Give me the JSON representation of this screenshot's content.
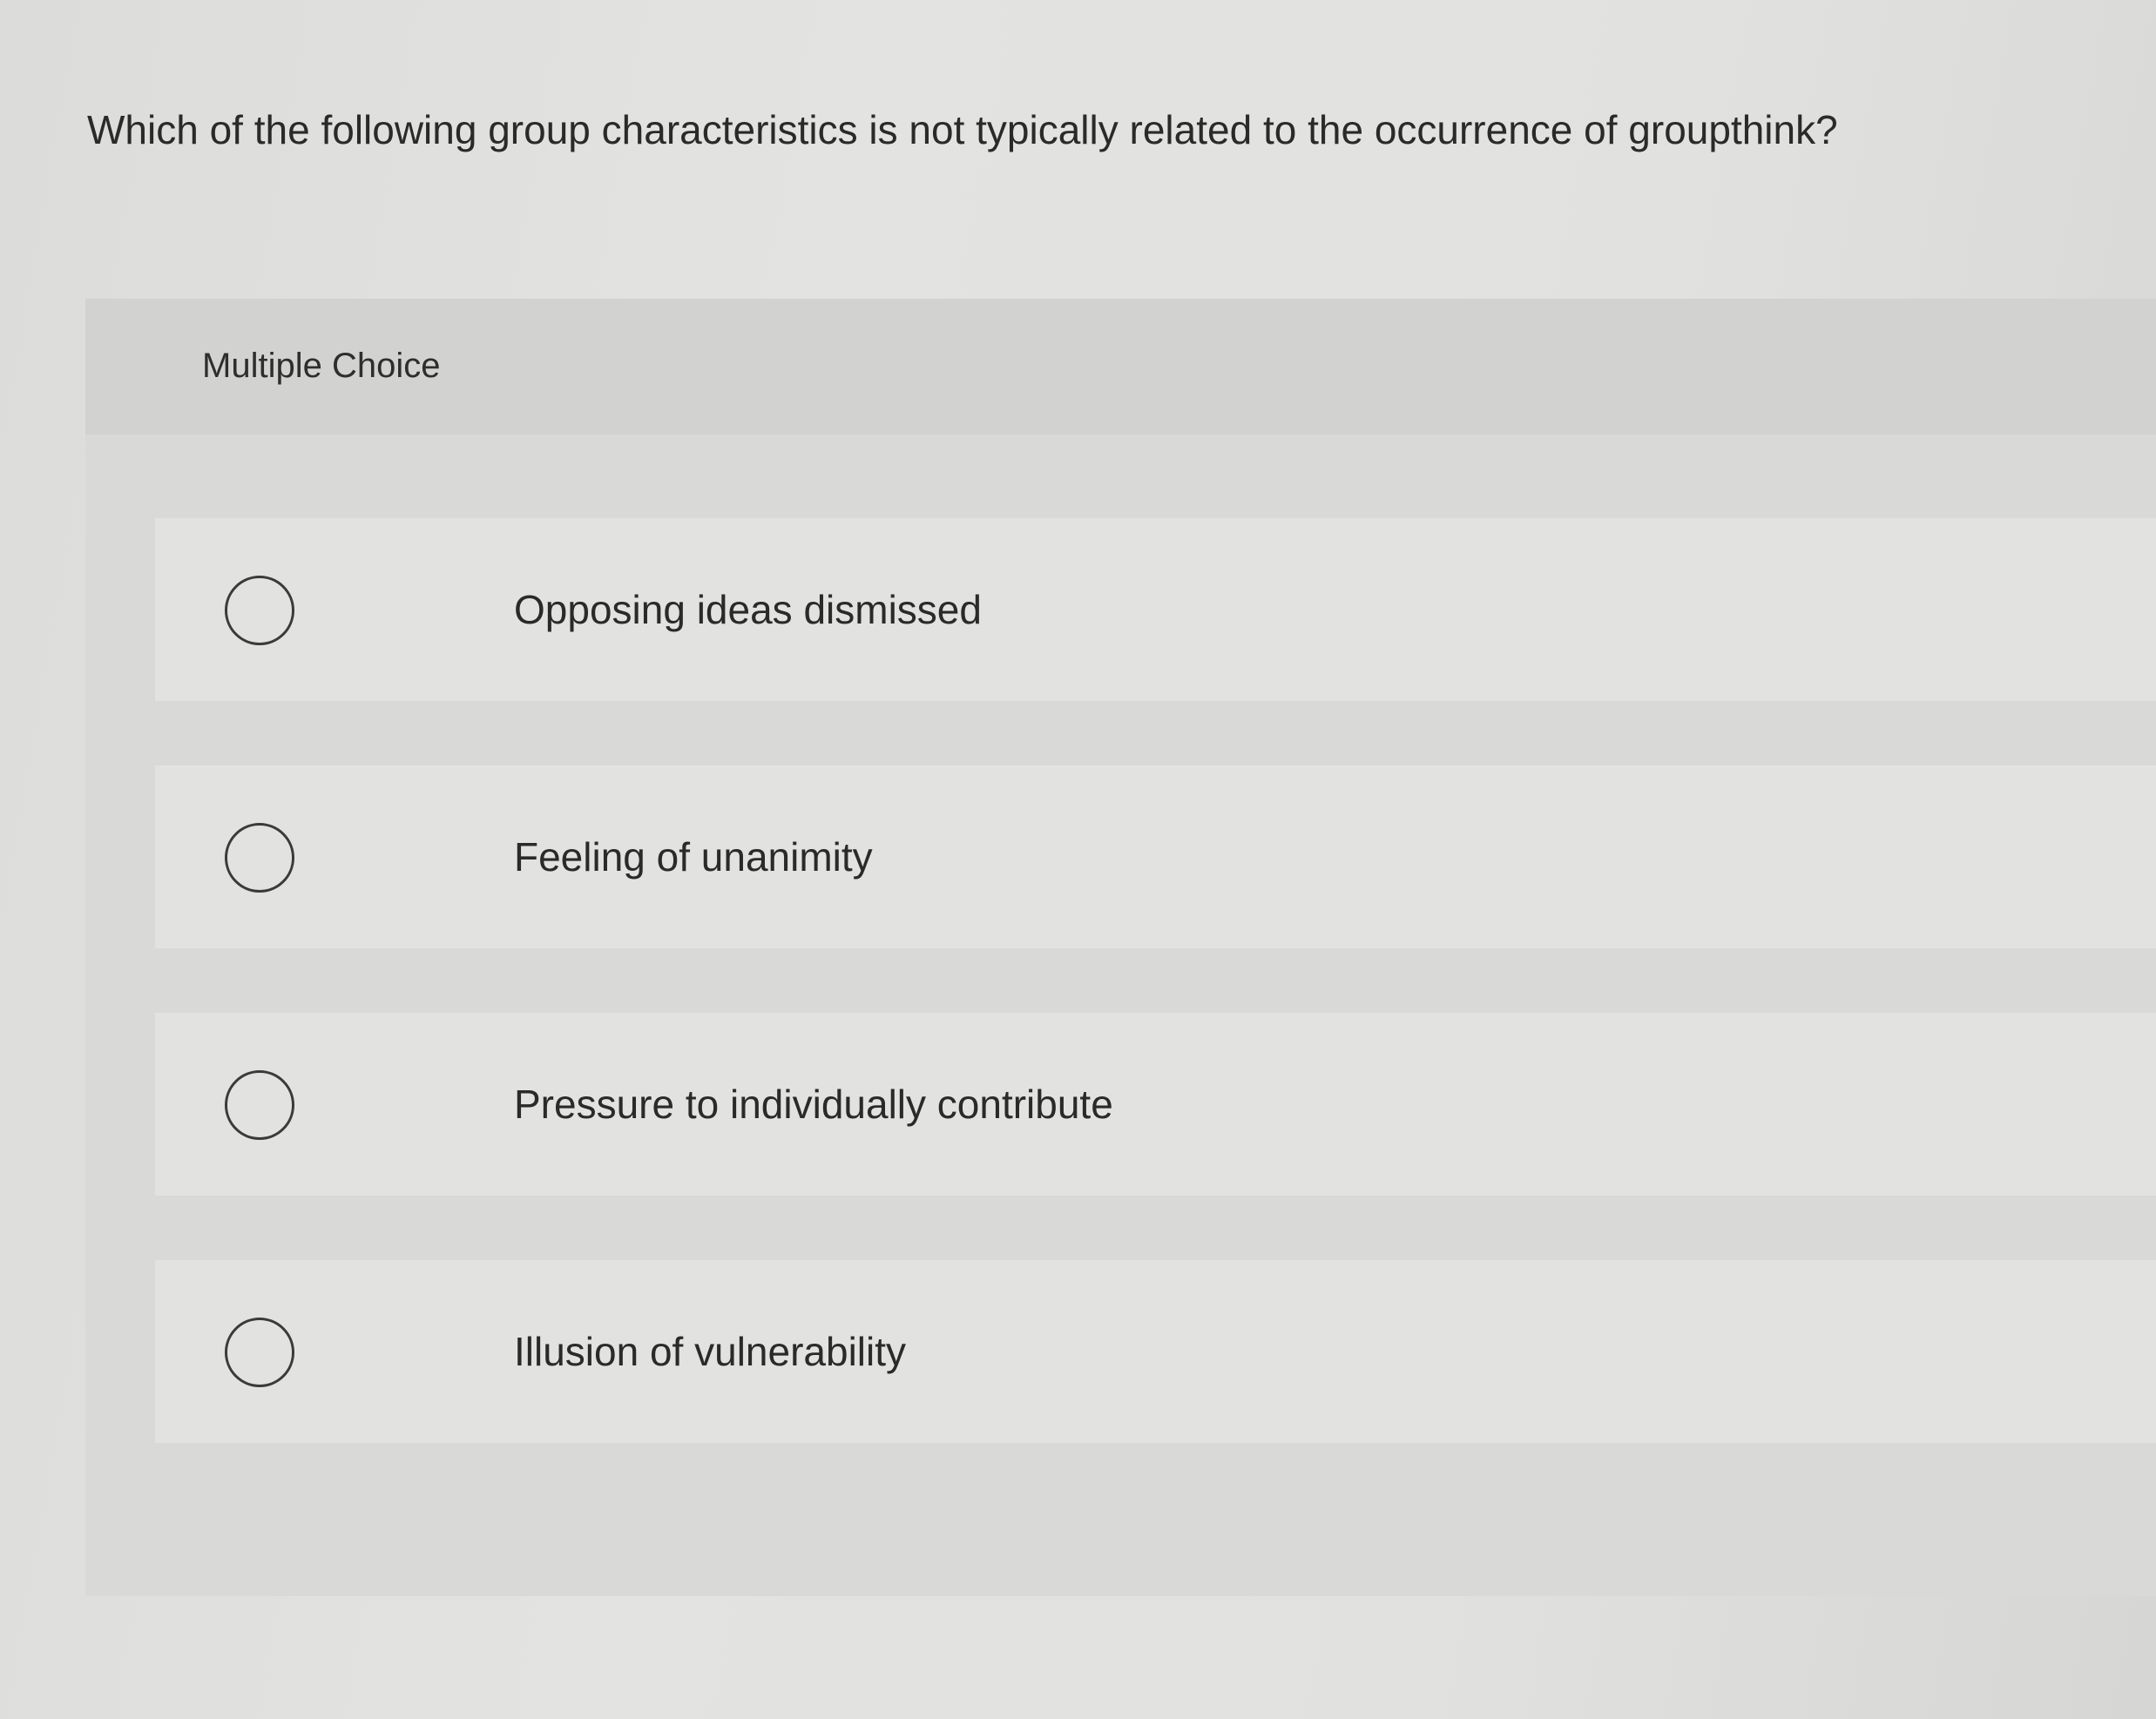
{
  "question": {
    "text": "Which of the following group characteristics is not typically related to the occurrence of groupthink?"
  },
  "panel": {
    "title": "Multiple Choice"
  },
  "choices": [
    {
      "label": "Opposing ideas dismissed",
      "selected": false
    },
    {
      "label": "Feeling of unanimity",
      "selected": false
    },
    {
      "label": "Pressure to individually contribute",
      "selected": false
    },
    {
      "label": "Illusion of vulnerability",
      "selected": false
    }
  ]
}
